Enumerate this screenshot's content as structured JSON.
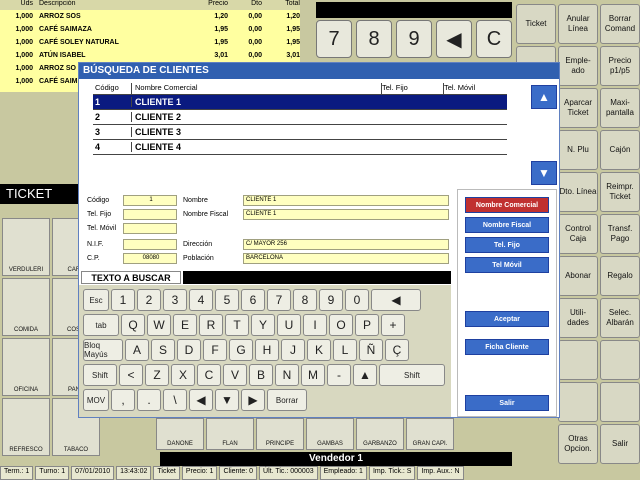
{
  "ticket": {
    "headers": [
      "Uds",
      "Descripción",
      "Precio",
      "Dto",
      "Total"
    ],
    "rows": [
      [
        "1,000",
        "ARROZ SOS",
        "1,20",
        "0,00",
        "1,20"
      ],
      [
        "1,000",
        "CAFÉ SAIMAZA",
        "1,95",
        "0,00",
        "1,95"
      ],
      [
        "1,000",
        "CAFÉ SOLEY NATURAL",
        "1,95",
        "0,00",
        "1,95"
      ],
      [
        "1,000",
        "ATÚN ISABEL",
        "3,01",
        "0,00",
        "3,01"
      ],
      [
        "1,000",
        "ARROZ SO",
        "",
        "",
        ""
      ],
      [
        "1,000",
        "CAFÉ SAIM",
        "",
        "",
        ""
      ]
    ],
    "label": "TICKET"
  },
  "numpad": [
    "7",
    "8",
    "9",
    "◀",
    "C"
  ],
  "right_panel": [
    [
      "Ticket",
      "Anular Línea",
      "Borrar Comand"
    ],
    [
      "Compro-",
      "Emple- ado",
      "Precio p1/p5"
    ],
    [
      "",
      "Aparcar Ticket",
      "Maxi- pantalla"
    ],
    [
      "",
      "N. Plu",
      "Cajón"
    ],
    [
      "",
      "Dto. Línea",
      "Reimpr. Ticket"
    ],
    [
      "",
      "Control Caja",
      "Transf. Pago"
    ],
    [
      "",
      "Abonar",
      "Regalo"
    ],
    [
      "",
      "Utili- dades",
      "Selec. Albarán"
    ],
    [
      "",
      "",
      ""
    ],
    [
      "",
      "",
      ""
    ],
    [
      "",
      "Otras Opcion.",
      "Salir"
    ]
  ],
  "products_left": [
    "VERDULERI",
    "CARN",
    "COMIDA",
    "COSM",
    "OFICINA",
    "PANA",
    "REFRESCO",
    "TABACO"
  ],
  "products_bottom": [
    "DANONE",
    "FLAN",
    "PRINCIPE",
    "GAMBAS",
    "GARBANZO",
    "GRAN CAPI."
  ],
  "dialog": {
    "title": "BÚSQUEDA DE CLIENTES",
    "grid_headers": [
      "Código",
      "Nombre Comercial",
      "Tel. Fijo",
      "Tel. Móvil"
    ],
    "grid_rows": [
      [
        "1",
        "CLIENTE 1"
      ],
      [
        "2",
        "CLIENTE 2"
      ],
      [
        "3",
        "CLIENTE 3"
      ],
      [
        "4",
        "CLIENTE 4"
      ]
    ],
    "fields": {
      "codigo_label": "Código",
      "codigo": "1",
      "nombre_label": "Nombre",
      "nombre": "CLIENTE 1",
      "telfijo_label": "Tel. Fijo",
      "nombre_fiscal_label": "Nombre Fiscal",
      "nombre_fiscal": "CLIENTE 1",
      "telmovil_label": "Tel. Móvil",
      "nif_label": "N.I.F.",
      "direccion_label": "Dirección",
      "direccion": "C/ MAYOR 256",
      "cp_label": "C.P.",
      "cp": "08080",
      "poblacion_label": "Población",
      "poblacion": "BARCELONA"
    },
    "search_label": "TEXTO A BUSCAR",
    "sort_buttons": [
      "Nombre Comercial",
      "Nombre Fiscal",
      "Tel. Fijo",
      "Tel Móvil"
    ],
    "action_buttons": [
      "Aceptar",
      "Ficha Cliente",
      "Salir"
    ]
  },
  "keyboard": {
    "row1": [
      "Esc",
      "1",
      "2",
      "3",
      "4",
      "5",
      "6",
      "7",
      "8",
      "9",
      "0",
      "◀"
    ],
    "row2": [
      "tab",
      "Q",
      "W",
      "E",
      "R",
      "T",
      "Y",
      "U",
      "I",
      "O",
      "P",
      "+"
    ],
    "row3": [
      "Bloq Mayús",
      "A",
      "S",
      "D",
      "F",
      "G",
      "H",
      "J",
      "K",
      "L",
      "Ñ",
      "Ç"
    ],
    "row4": [
      "Shift",
      "<",
      "Z",
      "X",
      "C",
      "V",
      "B",
      "N",
      "M",
      "-",
      "▲",
      "Shift"
    ],
    "row5": [
      "MOV",
      ",",
      ".",
      "\\",
      "◀",
      "▼",
      "▶",
      "Borrar"
    ]
  },
  "seller": "Vendedor 1",
  "status": [
    "Term.: 1",
    "Turno: 1",
    "07/01/2010",
    "13:43:02",
    "Ticket",
    "Precio: 1",
    "Cliente: 0",
    "Últ. Tic.: 000003",
    "Empleado: 1",
    "Imp. Tick.: S",
    "Imp. Aux.: N"
  ]
}
